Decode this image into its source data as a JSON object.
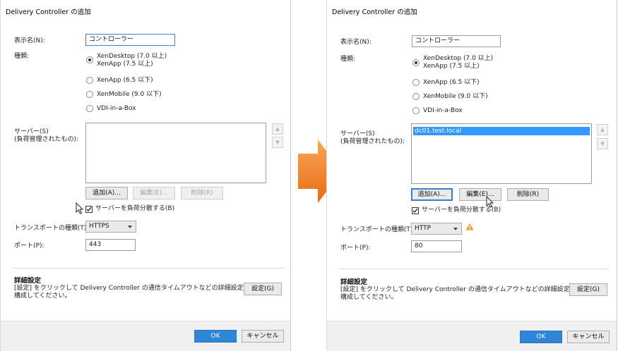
{
  "left": {
    "title": "Delivery Controller の追加",
    "display_name_label": "表示名(N):",
    "display_name_value": "コントローラー",
    "type_label": "種類:",
    "types": [
      {
        "line1": "XenDesktop (7.0 以上)",
        "line2": "XenApp (7.5 以上)",
        "selected": true
      },
      {
        "line1": "XenApp (6.5 以下)",
        "line2": "",
        "selected": false
      },
      {
        "line1": "XenMobile (9.0 以下)",
        "line2": "",
        "selected": false
      },
      {
        "line1": "VDI-in-a-Box",
        "line2": "",
        "selected": false
      }
    ],
    "servers_label_1": "サーバー(S)",
    "servers_label_2": "(負荷管理されたもの):",
    "servers": [],
    "add_button": "追加(A)...",
    "edit_button": "編集(E)...",
    "delete_button": "削除(R)",
    "load_balance_label": "サーバーを負荷分散する(B)",
    "transport_label": "トランスポートの種類(T):",
    "transport_value": "HTTPS",
    "port_label": "ポート(P):",
    "port_value": "443",
    "advanced_title": "詳細設定",
    "advanced_desc_1": "[設定] をクリックして Delivery Controller の通信タイムアウトなどの詳細設定を",
    "advanced_desc_2": "構成してください。",
    "settings_button": "設定(G)",
    "ok_button": "OK",
    "cancel_button": "キャンセル"
  },
  "right": {
    "title": "Delivery Controller の追加",
    "display_name_label": "表示名(N):",
    "display_name_value": "コントローラー",
    "type_label": "種類:",
    "types": [
      {
        "line1": "XenDesktop (7.0 以上)",
        "line2": "XenApp (7.5 以上)",
        "selected": true
      },
      {
        "line1": "XenApp (6.5 以下)",
        "line2": "",
        "selected": false
      },
      {
        "line1": "XenMobile (9.0 以下)",
        "line2": "",
        "selected": false
      },
      {
        "line1": "VDI-in-a-Box",
        "line2": "",
        "selected": false
      }
    ],
    "servers_label_1": "サーバー(S)",
    "servers_label_2": "(負荷管理されたもの):",
    "servers": [
      "dc01.test.local"
    ],
    "add_button": "追加(A)...",
    "edit_button": "編集(E)...",
    "delete_button": "削除(R)",
    "load_balance_label": "サーバーを負荷分散する(B)",
    "transport_label": "トランスポートの種類(T):",
    "transport_value": "HTTP",
    "port_label": "ポート(P):",
    "port_value": "80",
    "advanced_title": "詳細設定",
    "advanced_desc_1": "[設定] をクリックして Delivery Controller の通信タイムアウトなどの詳細設定を",
    "advanced_desc_2": "構成してください。",
    "settings_button": "設定(G)",
    "ok_button": "OK",
    "cancel_button": "キャンセル"
  },
  "colors": {
    "accent": "#2f86d6",
    "arrow": "#f07c22",
    "warning": "#f0a030",
    "selection": "#3399ff"
  }
}
